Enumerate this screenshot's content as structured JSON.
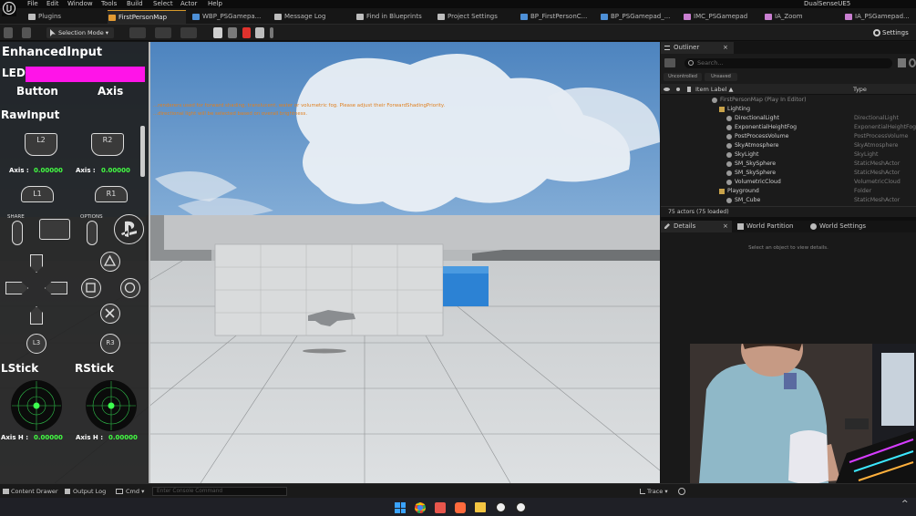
{
  "menu": {
    "items": [
      "File",
      "Edit",
      "Window",
      "Tools",
      "Build",
      "Select",
      "Actor",
      "Help"
    ],
    "project_name": "DualSenseUE5"
  },
  "tabs": [
    {
      "label": "Plugins",
      "color": "#bdbdbd"
    },
    {
      "label": "FirstPersonMap",
      "color": "#e29a33",
      "active": true
    },
    {
      "label": "WBP_PSGamepa...",
      "color": "#4d8fd6"
    },
    {
      "label": "Message Log",
      "color": "#bdbdbd"
    },
    {
      "label": "Find in Blueprints",
      "color": "#bdbdbd"
    },
    {
      "label": "Project Settings",
      "color": "#bdbdbd"
    },
    {
      "label": "BP_FirstPersonC...",
      "color": "#4d8fd6"
    },
    {
      "label": "BP_PSGamepad_...",
      "color": "#4d8fd6"
    },
    {
      "label": "IMC_PSGamepad",
      "color": "#c97fd1"
    },
    {
      "label": "IA_Zoom",
      "color": "#c97fd1"
    },
    {
      "label": "IA_PSGamepad...",
      "color": "#c97fd1"
    }
  ],
  "toolbar": {
    "selection_mode": "Selection Mode",
    "settings": "Settings"
  },
  "overlay": {
    "title": "EnhancedInput",
    "led_label": "LED",
    "led_color": "#ff14e8",
    "col_button": "Button",
    "col_axis": "Axis",
    "raw_title": "RawInput",
    "warning_line1": "...renderers used for forward shading, translucent, water or volumetric fog. Please adjust their ForwardShadingPriority.",
    "warning_line2": "...directional light will be selected based on overall brightness.",
    "l2": "L2",
    "r2": "R2",
    "axis_label": "Axis :",
    "l2_axis": "0.00000",
    "r2_axis": "0.00000",
    "l1": "L1",
    "r1": "R1",
    "share": "SHARE",
    "options": "OPTIONS",
    "l3": "L3",
    "r3": "R3",
    "lstick": "LStick",
    "rstick": "RStick",
    "axis_h_label": "Axis H :",
    "lstick_axis": "0.00000",
    "rstick_axis": "0.00000"
  },
  "outliner": {
    "title": "Outliner",
    "search_placeholder": "Search...",
    "filter_unc": "Uncontrolled",
    "filter_unsaved": "Unsaved",
    "col_label": "Item Label ▲",
    "col_type": "Type",
    "rows": [
      {
        "label": "FirstPersonMap (Play In Editor)",
        "type": "",
        "indent": 0,
        "icon": "map-icon"
      },
      {
        "label": "Lighting",
        "type": "",
        "indent": 1,
        "icon": "folder-icon"
      },
      {
        "label": "DirectionalLight",
        "type": "DirectionalLight",
        "indent": 2,
        "icon": "light-icon"
      },
      {
        "label": "ExponentialHeightFog",
        "type": "ExponentialHeightFog",
        "indent": 2,
        "icon": "fog-icon"
      },
      {
        "label": "PostProcessVolume",
        "type": "PostProcessVolume",
        "indent": 2,
        "icon": "volume-icon"
      },
      {
        "label": "SkyAtmosphere",
        "type": "SkyAtmosphere",
        "indent": 2,
        "icon": "sky-icon"
      },
      {
        "label": "SkyLight",
        "type": "SkyLight",
        "indent": 2,
        "icon": "light-icon"
      },
      {
        "label": "SM_SkySphere",
        "type": "StaticMeshActor",
        "indent": 2,
        "icon": "mesh-icon"
      },
      {
        "label": "SM_SkySphere",
        "type": "StaticMeshActor",
        "indent": 2,
        "icon": "mesh-icon"
      },
      {
        "label": "VolumetricCloud",
        "type": "VolumetricCloud",
        "indent": 2,
        "icon": "cloud-icon"
      },
      {
        "label": "Playground",
        "type": "Folder",
        "indent": 1,
        "icon": "folder-icon"
      },
      {
        "label": "SM_Cube",
        "type": "StaticMeshActor",
        "indent": 2,
        "icon": "mesh-icon"
      }
    ],
    "actor_count": "75 actors (75 loaded)"
  },
  "details": {
    "tab_details": "Details",
    "tab_world_partition": "World Partition",
    "tab_world_settings": "World Settings",
    "empty_text": "Select an object to view details."
  },
  "bottom": {
    "content_drawer": "Content Drawer",
    "output_log": "Output Log",
    "cmd": "Cmd",
    "console_placeholder": "Enter Console Command",
    "trace": "Trace"
  },
  "taskbar": {
    "icons": [
      "windows-start-icon",
      "chrome-icon",
      "app-icon",
      "app-icon",
      "file-explorer-icon",
      "unreal-engine-icon",
      "unreal-engine-icon"
    ]
  }
}
